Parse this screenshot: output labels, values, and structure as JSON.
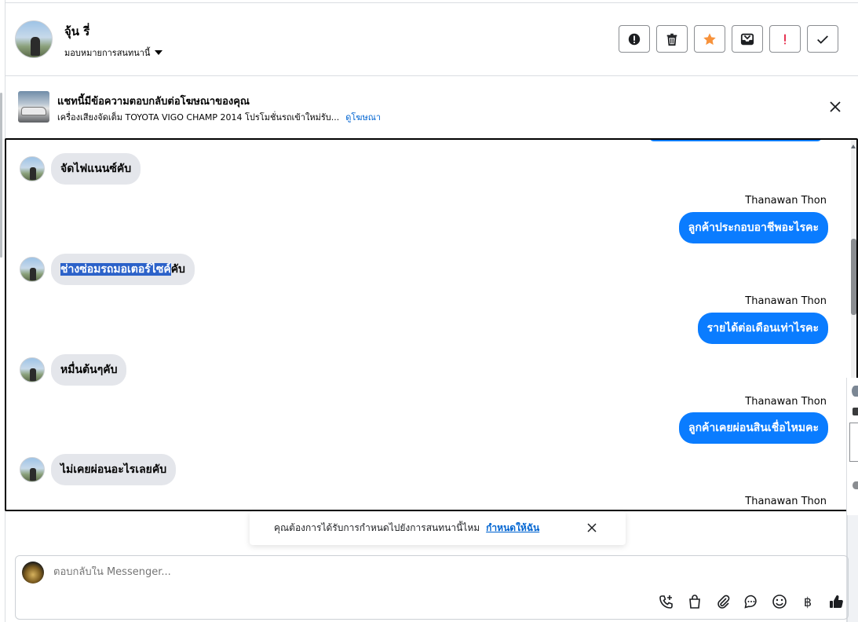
{
  "header": {
    "contact_name": "จุ้น รี่",
    "assign_label": "มอบหมายการสนทนานี้",
    "actions": [
      {
        "name": "report-spam-button",
        "icon": "alert-circle-icon",
        "color": "#1c1e21"
      },
      {
        "name": "delete-button",
        "icon": "trash-icon",
        "color": "#1c1e21"
      },
      {
        "name": "star-button",
        "icon": "star-icon",
        "color": "#f7923b"
      },
      {
        "name": "move-to-inbox-button",
        "icon": "inbox-icon",
        "color": "#1c1e21"
      },
      {
        "name": "mark-important-button",
        "icon": "exclamation-icon",
        "color": "#e41e3f"
      },
      {
        "name": "mark-done-button",
        "icon": "check-icon",
        "color": "#1c1e21"
      }
    ]
  },
  "ad": {
    "title": "แชทนี้มีข้อความตอบกลับต่อโฆษณาของคุณ",
    "subtitle": "เครื่องเสียงจัดเต็ม TOYOTA VIGO CHAMP 2014 โปรโมชั่นรถเข้าใหม่รับ...",
    "link": "ดูโฆษณา"
  },
  "messages": {
    "incoming": [
      {
        "pre": "",
        "selected": "",
        "text": "จัดไฟแนนซ์คับ"
      },
      {
        "pre": "",
        "selected": "ช่างซ่อมรถมอเตอร์ไซค์",
        "text": "คับ"
      },
      {
        "pre": "",
        "selected": "",
        "text": "หมื่นต้นๆคับ"
      },
      {
        "pre": "",
        "selected": "",
        "text": "ไม่เคยผ่อนอะไรเลยคับ"
      }
    ],
    "outgoing": [
      {
        "sender": "Thanawan Thon",
        "text": "ลูกค้าประกอบอาชีพอะไรคะ"
      },
      {
        "sender": "Thanawan Thon",
        "text": "รายได้ต่อเดือนเท่าไรคะ"
      },
      {
        "sender": "Thanawan Thon",
        "text": "ลูกค้าเคยผ่อนสินเชื่อไหมคะ"
      },
      {
        "sender": "Thanawan Thon"
      }
    ]
  },
  "prompt": {
    "text": "คุณต้องการได้รับการกำหนดไปยังการสนทนานี้ไหม",
    "link": "กำหนดให้ฉัน"
  },
  "composer": {
    "placeholder": "ตอบกลับใน Messenger...",
    "tools": [
      "call-icon",
      "shopping-bag-icon",
      "paperclip-icon",
      "chat-bubble-icon",
      "emoji-icon",
      "baht-icon",
      "thumbs-up-icon"
    ],
    "baht_symbol": "฿"
  },
  "colors": {
    "accent": "#0a7cff",
    "incoming_bubble": "#e4e6eb",
    "selection": "#2c62c9",
    "link": "#0064d1"
  }
}
